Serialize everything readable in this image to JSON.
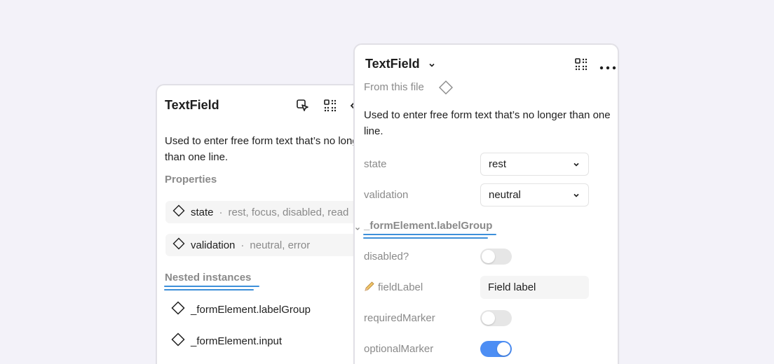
{
  "colors": {
    "background": "#f3f2f9",
    "panel": "#ffffff",
    "accent_underline": "#3d8fd9",
    "toggle_on": "#4d8ef4",
    "toggle_off": "#e6e6e6",
    "muted_text": "#8a8a8a"
  },
  "left_panel": {
    "title": "TextField",
    "header_icons": [
      "go-to-component-icon",
      "component-grid-icon",
      "chevron-left-icon"
    ],
    "description": "Used to enter free form text that’s no longer than one line.",
    "properties_label": "Properties",
    "properties": [
      {
        "name": "state",
        "separator": "·",
        "values": "rest, focus, disabled, read"
      },
      {
        "name": "validation",
        "separator": "·",
        "values": "neutral, error"
      }
    ],
    "nested_label": "Nested instances",
    "nested": [
      {
        "name": "_formElement.labelGroup"
      },
      {
        "name": "_formElement.input"
      }
    ]
  },
  "right_panel": {
    "title": "TextField",
    "header_icons": [
      "chevron-down-icon",
      "component-grid-icon",
      "more-icon"
    ],
    "source": "From this file",
    "description": "Used to enter free form text that’s no longer than one line.",
    "selects": [
      {
        "label": "state",
        "value": "rest"
      },
      {
        "label": "validation",
        "value": "neutral"
      }
    ],
    "nested_header": "_formElement.labelGroup",
    "toggles": [
      {
        "label": "disabled?",
        "on": false
      },
      {
        "label": "requiredMarker",
        "on": false
      },
      {
        "label": "optionalMarker",
        "on": true
      }
    ],
    "field_label": {
      "label": "fieldLabel",
      "icon": "pencil-icon",
      "value": "Field label"
    }
  }
}
